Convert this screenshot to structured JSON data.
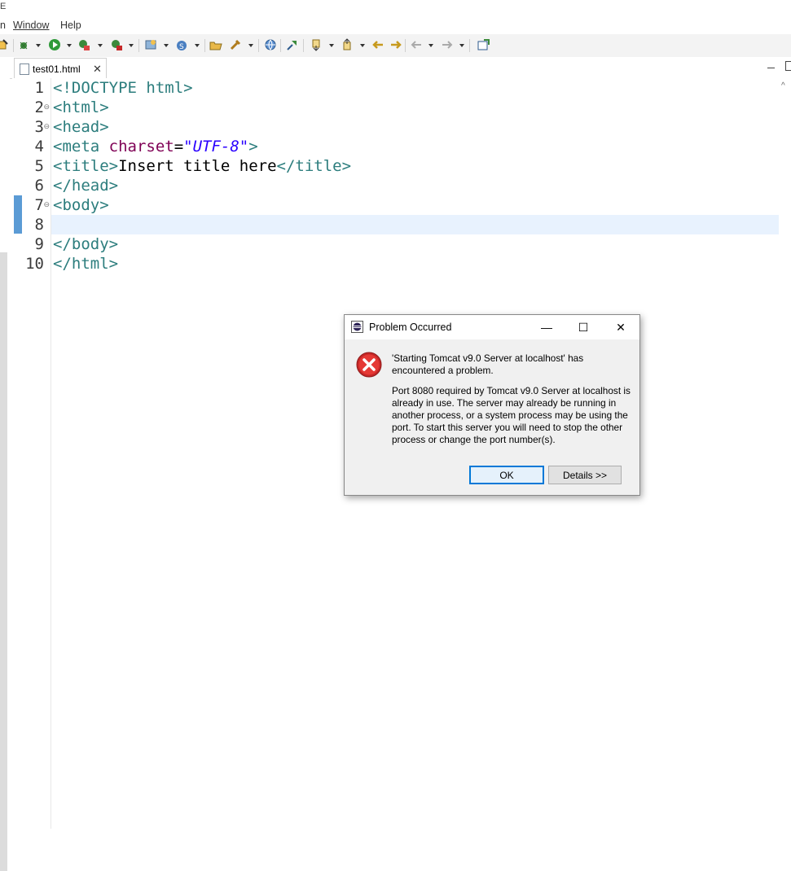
{
  "titlebar": {
    "partial": "E"
  },
  "menu": {
    "partial": "n",
    "window": "Window",
    "help": "Help"
  },
  "editor": {
    "tab_label": "test01.html",
    "lines": [
      {
        "num": "1",
        "fold": false
      },
      {
        "num": "2",
        "fold": true
      },
      {
        "num": "3",
        "fold": true
      },
      {
        "num": "4",
        "fold": false
      },
      {
        "num": "5",
        "fold": false
      },
      {
        "num": "6",
        "fold": false
      },
      {
        "num": "7",
        "fold": true
      },
      {
        "num": "8",
        "fold": false
      },
      {
        "num": "9",
        "fold": false
      },
      {
        "num": "10",
        "fold": false
      }
    ],
    "code": {
      "l1": "<!DOCTYPE html>",
      "l2": "<html>",
      "l3": "<head>",
      "l4_tag_open": "<meta ",
      "l4_attr": "charset",
      "l4_eq": "=",
      "l4_val": "\"UTF-8\"",
      "l4_close": ">",
      "l5_open": "<title>",
      "l5_text": "Insert title here",
      "l5_close": "</title>",
      "l6": "</head>",
      "l7": "<body>",
      "l9": "</body>",
      "l10": "</html>"
    },
    "current_line": 8
  },
  "dialog": {
    "title": "Problem Occurred",
    "message": "'Starting Tomcat v9.0 Server at localhost' has encountered a problem.",
    "detail": "Port 8080 required by Tomcat v9.0 Server at localhost is already in use. The server may already be running in another process, or a system process may be using the port. To start this server you will need to stop the other process or change the port number(s).",
    "ok_label": "OK",
    "details_label": "Details >>",
    "minimize": "—",
    "maximize": "☐",
    "close": "✕"
  },
  "colors": {
    "tag": "#2c7d7d",
    "attr": "#7f0055",
    "string": "#2a00ff",
    "current_line": "#e8f2fe",
    "error": "#d32f2f"
  }
}
